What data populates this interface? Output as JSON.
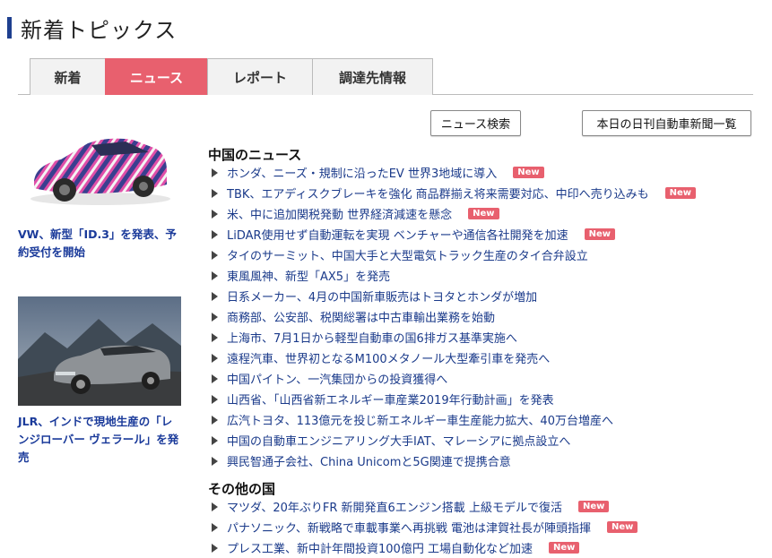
{
  "page_title": "新着トピックス",
  "tabs": [
    {
      "label": "新着",
      "active": false
    },
    {
      "label": "ニュース",
      "active": true
    },
    {
      "label": "レポート",
      "active": false
    },
    {
      "label": "調達先情報",
      "active": false
    }
  ],
  "buttons": {
    "news_search": "ニュース検索",
    "daily_paper_list": "本日の日刊自動車新聞一覧"
  },
  "features": [
    {
      "caption": "VW、新型「ID.3」を発表、予約受付を開始"
    },
    {
      "caption": "JLR、インドで現地生産の「レンジローバー ヴェラール」を発売"
    }
  ],
  "badge_label": "New",
  "sections": [
    {
      "title": "中国のニュース",
      "items": [
        {
          "text": "ホンダ、ニーズ・規制に沿ったEV 世界3地域に導入",
          "is_new": true
        },
        {
          "text": "TBK、エアディスクブレーキを強化 商品群揃え将来需要対応、中印へ売り込みも",
          "is_new": true
        },
        {
          "text": "米、中に追加関税発動 世界経済減速を懸念",
          "is_new": true
        },
        {
          "text": "LiDAR使用せず自動運転を実現 ベンチャーや通信各社開発を加速",
          "is_new": true
        },
        {
          "text": "タイのサーミット、中国大手と大型電気トラック生産のタイ合弁設立",
          "is_new": false
        },
        {
          "text": "東風風神、新型「AX5」を発売",
          "is_new": false
        },
        {
          "text": "日系メーカー、4月の中国新車販売はトヨタとホンダが増加",
          "is_new": false
        },
        {
          "text": "商務部、公安部、税関総署は中古車輸出業務を始動",
          "is_new": false
        },
        {
          "text": "上海市、7月1日から軽型自動車の国6排ガス基準実施へ",
          "is_new": false
        },
        {
          "text": "遠程汽車、世界初となるM100メタノール大型牽引車を発売へ",
          "is_new": false
        },
        {
          "text": "中国パイトン、一汽集団からの投資獲得へ",
          "is_new": false
        },
        {
          "text": "山西省、「山西省新エネルギー車産業2019年行動計画」を発表",
          "is_new": false
        },
        {
          "text": "広汽トヨタ、113億元を投じ新エネルギー車生産能力拡大、40万台増産へ",
          "is_new": false
        },
        {
          "text": "中国の自動車エンジニアリング大手IAT、マレーシアに拠点設立へ",
          "is_new": false
        },
        {
          "text": "興民智通子会社、China Unicomと5G関連で提携合意",
          "is_new": false
        }
      ]
    },
    {
      "title": "その他の国",
      "items": [
        {
          "text": "マツダ、20年ぶりFR 新開発直6エンジン搭載 上級モデルで復活",
          "is_new": true
        },
        {
          "text": "パナソニック、新戦略で車載事業へ再挑戦 電池は津賀社長が陣頭指揮",
          "is_new": true
        },
        {
          "text": "プレス工業、新中計年間投資100億円 工場自動化など加速",
          "is_new": true
        }
      ]
    }
  ],
  "colors": {
    "accent": "#e8606e",
    "link": "#1a3a8a",
    "title_bar": "#1e3f8f"
  }
}
